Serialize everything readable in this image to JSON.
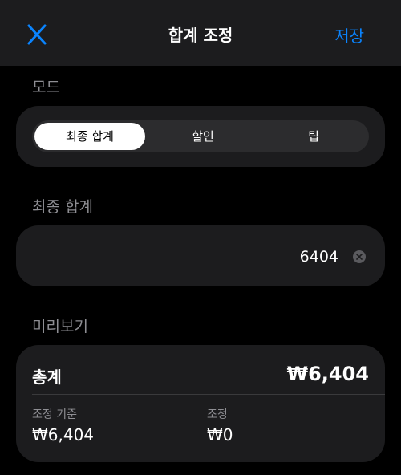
{
  "nav": {
    "title": "합계 조정",
    "save_label": "저장",
    "close_icon": "close-icon"
  },
  "mode": {
    "section_label": "모드",
    "options": [
      "최종 합계",
      "할인",
      "팁"
    ],
    "selected": "최종 합계"
  },
  "final_total": {
    "section_label": "최종 합계",
    "value": "6404",
    "clear_icon": "clear-icon"
  },
  "preview": {
    "section_label": "미리보기",
    "total_label": "총계",
    "total_value": "₩6,404",
    "base_label": "조정 기준",
    "base_value": "₩6,404",
    "adjustment_label": "조정",
    "adjustment_value": "₩0"
  },
  "colors": {
    "accent": "#0a84ff",
    "background": "#000000",
    "card": "#1c1c1e"
  }
}
